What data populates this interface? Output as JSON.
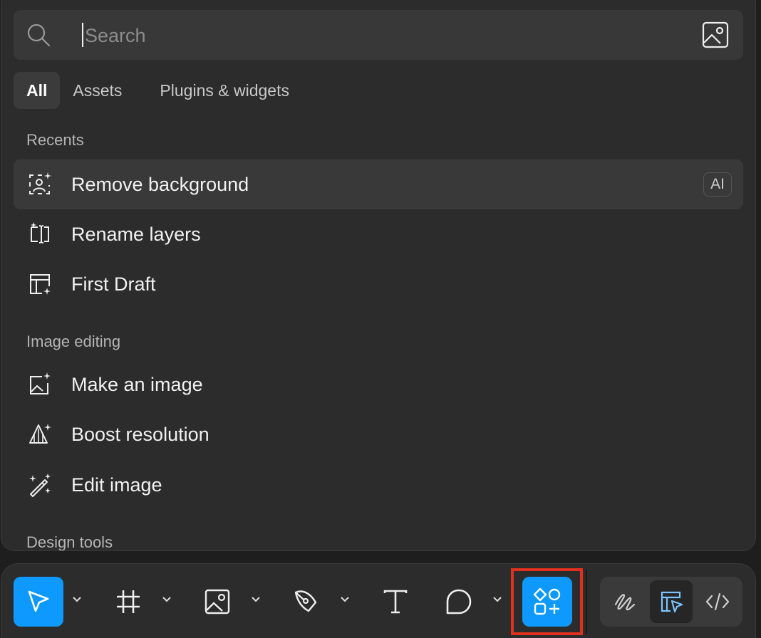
{
  "search": {
    "placeholder": "Search"
  },
  "tabs": [
    {
      "label": "All",
      "active": true
    },
    {
      "label": "Assets"
    },
    {
      "label": "Plugins & widgets"
    }
  ],
  "sections": {
    "recents": {
      "title": "Recents",
      "items": [
        {
          "label": "Remove background",
          "icon": "remove-background-icon",
          "badge": "AI"
        },
        {
          "label": "Rename layers",
          "icon": "rename-layers-icon"
        },
        {
          "label": "First Draft",
          "icon": "first-draft-icon"
        }
      ]
    },
    "image_editing": {
      "title": "Image editing",
      "items": [
        {
          "label": "Make an image",
          "icon": "make-image-icon"
        },
        {
          "label": "Boost resolution",
          "icon": "boost-resolution-icon"
        },
        {
          "label": "Edit image",
          "icon": "edit-image-icon"
        }
      ]
    },
    "design_tools": {
      "title": "Design tools"
    }
  },
  "toolbar": {
    "tools": [
      "move-tool",
      "frame-tool",
      "image-tool",
      "pen-tool",
      "text-tool",
      "comment-tool",
      "actions-tool"
    ],
    "active_tool": "move-tool",
    "highlighted_tool": "actions-tool",
    "modes": [
      "draw-mode",
      "design-mode",
      "dev-mode"
    ],
    "active_mode": "design-mode"
  },
  "colors": {
    "accent": "#0d99ff",
    "panel": "#2c2c2c",
    "highlight_box": "#e0311e"
  }
}
